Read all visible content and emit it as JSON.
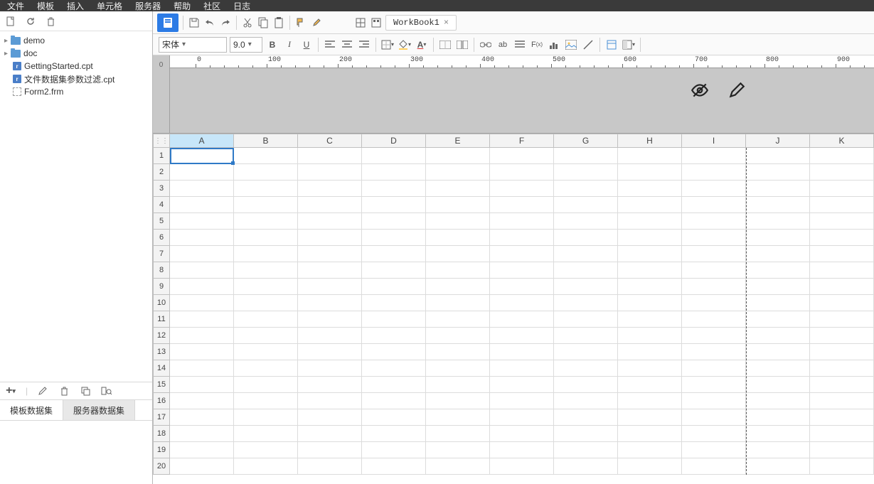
{
  "menu": {
    "items": [
      "文件",
      "模板",
      "插入",
      "单元格",
      "服务器",
      "帮助",
      "社区"
    ],
    "right": "日志"
  },
  "topToolbar": {
    "tabs": [
      {
        "label": "WorkBook1",
        "active": true
      }
    ]
  },
  "format": {
    "font": "宋体",
    "size": "9.0"
  },
  "tree": {
    "items": [
      {
        "type": "folder",
        "label": "demo"
      },
      {
        "type": "folder",
        "label": "doc"
      },
      {
        "type": "cpt",
        "label": "GettingStarted.cpt"
      },
      {
        "type": "cpt",
        "label": "文件数据集参数过滤.cpt"
      },
      {
        "type": "frm",
        "label": "Form2.frm"
      }
    ]
  },
  "dataset": {
    "tabs": [
      "模板数据集",
      "服务器数据集"
    ]
  },
  "ruler": {
    "zero": "0",
    "ticks": [
      0,
      100,
      200,
      300,
      400,
      500,
      600,
      700,
      800,
      900
    ]
  },
  "grid": {
    "columns": [
      "A",
      "B",
      "C",
      "D",
      "E",
      "F",
      "G",
      "H",
      "I",
      "J",
      "K"
    ],
    "rows": [
      1,
      2,
      3,
      4,
      5,
      6,
      7,
      8,
      9,
      10,
      11,
      12,
      13,
      14,
      15,
      16,
      17,
      18,
      19,
      20
    ],
    "selectedCell": "A1",
    "pageBreakAfterCol": "I"
  }
}
